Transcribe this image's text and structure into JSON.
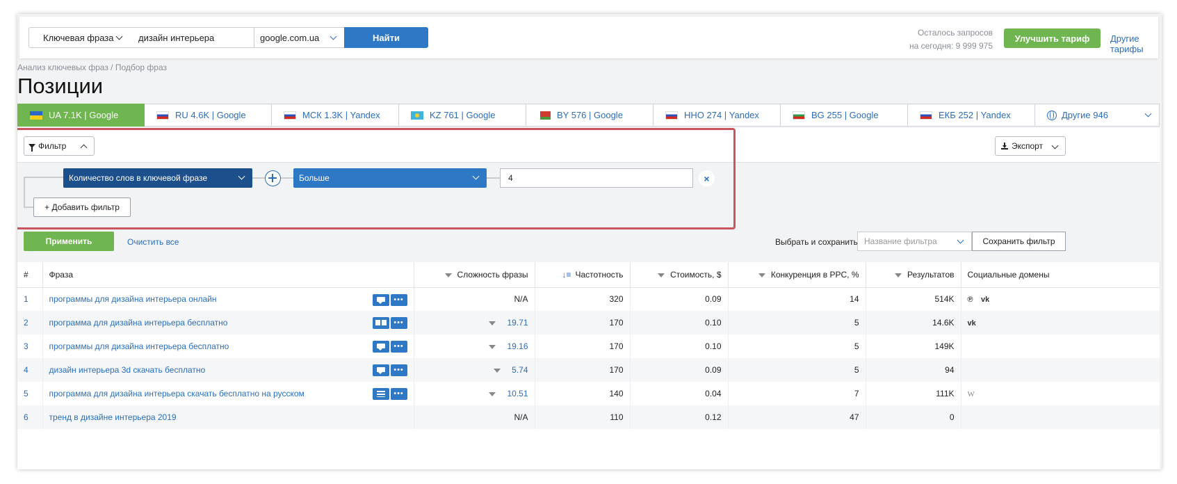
{
  "search": {
    "type_label": "Ключевая фраза",
    "phrase_value": "дизайн интерьера",
    "engine_label": "google.com.ua",
    "find_label": "Найти"
  },
  "quota": {
    "line1": "Осталось запросов",
    "line2": "на сегодня: 9 999 975"
  },
  "header": {
    "upgrade_label": "Улучшить тариф",
    "other_plans_label": "Другие тарифы"
  },
  "breadcrumb": "Анализ ключевых фраз / Подбор фраз",
  "page_title": "Позиции",
  "tabs": [
    {
      "label": "UA 7.1K | Google",
      "flag": "ua",
      "active": true
    },
    {
      "label": "RU 4.6K | Google",
      "flag": "ru"
    },
    {
      "label": "МСК 1.3K | Yandex",
      "flag": "ru"
    },
    {
      "label": "KZ 761 | Google",
      "flag": "kz"
    },
    {
      "label": "BY 576 | Google",
      "flag": "by"
    },
    {
      "label": "ННО 274 | Yandex",
      "flag": "ru"
    },
    {
      "label": "BG 255 | Google",
      "flag": "bg"
    },
    {
      "label": "ЕКБ 252 | Yandex",
      "flag": "ru"
    },
    {
      "label": "Другие 946",
      "icon": "globe-icon"
    }
  ],
  "filter": {
    "toggle_label": "Фильтр",
    "export_label": "Экспорт",
    "field_label": "Количество слов в ключевой фразе",
    "operator_label": "Больше",
    "value": "4",
    "remove_label": "×",
    "add_label": "+ Добавить фильтр",
    "apply_label": "Применить",
    "clear_label": "Очистить все",
    "save_text": "Выбрать и сохранить",
    "save_placeholder": "Название фильтра",
    "save_button_label": "Сохранить фильтр"
  },
  "table": {
    "columns": {
      "num": "#",
      "phrase": "Фраза",
      "difficulty": "Сложность фразы",
      "frequency": "Частотность",
      "cost": "Стоимость, $",
      "competition": "Конкуренция в PPC, %",
      "results": "Результатов",
      "social": "Социальные домены"
    },
    "rows": [
      {
        "num": "1",
        "phrase": "программы для дизайна интерьера онлайн",
        "difficulty": "N/A",
        "frequency": "320",
        "cost": "0.09",
        "competition": "14",
        "results": "514K",
        "social": [
          "℗",
          "vk"
        ]
      },
      {
        "num": "2",
        "phrase": "программа для дизайна интерьера бесплатно",
        "difficulty": "19.71",
        "frequency": "170",
        "cost": "0.10",
        "competition": "5",
        "results": "14.6K",
        "social": [
          "vk"
        ]
      },
      {
        "num": "3",
        "phrase": "программы для дизайна интерьера бесплатно",
        "difficulty": "19.16",
        "frequency": "170",
        "cost": "0.10",
        "competition": "5",
        "results": "149K",
        "social": []
      },
      {
        "num": "4",
        "phrase": "дизайн интерьера 3d скачать бесплатно",
        "difficulty": "5.74",
        "frequency": "170",
        "cost": "0.09",
        "competition": "5",
        "results": "94",
        "social": []
      },
      {
        "num": "5",
        "phrase": "программа для дизайна интерьера скачать бесплатно на русском",
        "difficulty": "10.51",
        "frequency": "140",
        "cost": "0.04",
        "competition": "7",
        "results": "111K",
        "social": [
          "W"
        ]
      },
      {
        "num": "6",
        "phrase": "тренд в дизайне интерьера 2019",
        "difficulty": "N/A",
        "frequency": "110",
        "cost": "0.12",
        "competition": "47",
        "results": "0",
        "social": []
      }
    ]
  }
}
